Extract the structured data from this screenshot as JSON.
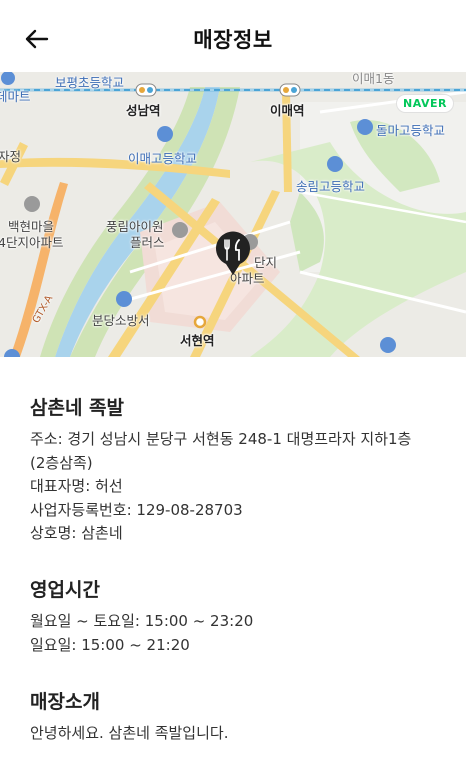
{
  "header": {
    "title": "매장정보",
    "back_icon": "arrow-left-icon"
  },
  "map": {
    "provider_logo": "NAVER",
    "labels": {
      "school_boryeong": "보평초등학교",
      "station_seongnam": "성남역",
      "station_imae": "이매역",
      "imae_dong": "이매1동",
      "e_mart": "데마트",
      "school_dolma": "돌마고등학교",
      "school_imae": "이매고등학교",
      "school_songrim": "송림고등학교",
      "baekhyeon_1": "백현마을",
      "baekhyeon_2": "4단지아파트",
      "pungrim_1": "풍림아이원",
      "pungrim_2": "플러스",
      "danji": "단지",
      "apart": "아파트",
      "fire_station": "분당소방서",
      "station_seohyeon": "서현역",
      "gtx": "GTX-A",
      "ajeong": "자정"
    },
    "marker_icon": "restaurant-marker-icon"
  },
  "store": {
    "name": "삼촌네 족발",
    "address_line1": "주소: 경기 성남시 분당구 서현동 248-1 대명프라자 지하1층",
    "address_line2": "(2층삼족)",
    "owner": "대표자명: 허선",
    "business_number": "사업자등록번호: 129-08-28703",
    "trade_name": "상호명: 삼촌네"
  },
  "hours": {
    "title": "영업시간",
    "weekday": "월요일 ~ 토요일: 15:00 ~ 23:20",
    "sunday": "일요일: 15:00 ~ 21:20"
  },
  "intro": {
    "title": "매장소개",
    "text": "안녕하세요. 삼촌네 족발입니다."
  }
}
